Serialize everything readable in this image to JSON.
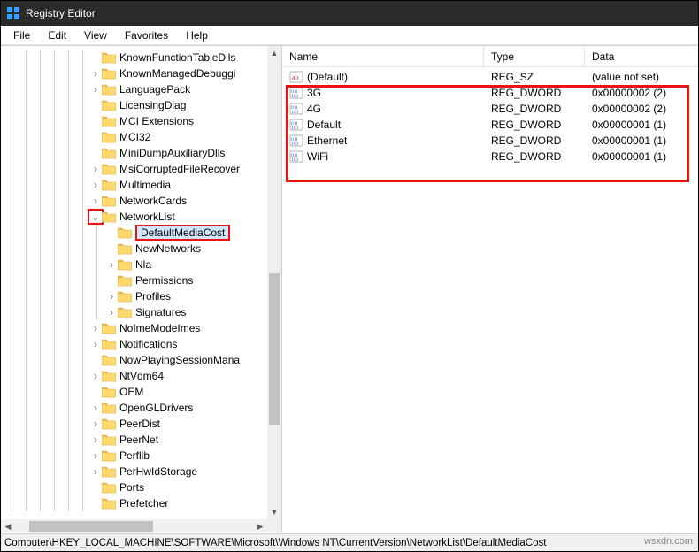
{
  "window": {
    "title": "Registry Editor"
  },
  "menu": {
    "file": "File",
    "edit": "Edit",
    "view": "View",
    "favorites": "Favorites",
    "help": "Help"
  },
  "tree": {
    "items": [
      {
        "label": "KnownFunctionTableDlls",
        "exp": "",
        "sub": false
      },
      {
        "label": "KnownManagedDebuggi",
        "exp": ">",
        "sub": false
      },
      {
        "label": "LanguagePack",
        "exp": ">",
        "sub": false
      },
      {
        "label": "LicensingDiag",
        "exp": "",
        "sub": false
      },
      {
        "label": "MCI Extensions",
        "exp": "",
        "sub": false
      },
      {
        "label": "MCI32",
        "exp": "",
        "sub": false
      },
      {
        "label": "MiniDumpAuxiliaryDlls",
        "exp": "",
        "sub": false
      },
      {
        "label": "MsiCorruptedFileRecover",
        "exp": ">",
        "sub": false
      },
      {
        "label": "Multimedia",
        "exp": ">",
        "sub": false
      },
      {
        "label": "NetworkCards",
        "exp": ">",
        "sub": false
      },
      {
        "label": "NetworkList",
        "exp": "v",
        "sub": false,
        "selexp": true
      },
      {
        "label": "DefaultMediaCost",
        "exp": "",
        "sub": true,
        "selected": true
      },
      {
        "label": "NewNetworks",
        "exp": "",
        "sub": true
      },
      {
        "label": "Nla",
        "exp": ">",
        "sub": true
      },
      {
        "label": "Permissions",
        "exp": "",
        "sub": true
      },
      {
        "label": "Profiles",
        "exp": ">",
        "sub": true
      },
      {
        "label": "Signatures",
        "exp": ">",
        "sub": true
      },
      {
        "label": "NoImeModeImes",
        "exp": ">",
        "sub": false
      },
      {
        "label": "Notifications",
        "exp": ">",
        "sub": false
      },
      {
        "label": "NowPlayingSessionMana",
        "exp": "",
        "sub": false
      },
      {
        "label": "NtVdm64",
        "exp": ">",
        "sub": false
      },
      {
        "label": "OEM",
        "exp": "",
        "sub": false
      },
      {
        "label": "OpenGLDrivers",
        "exp": ">",
        "sub": false
      },
      {
        "label": "PeerDist",
        "exp": ">",
        "sub": false
      },
      {
        "label": "PeerNet",
        "exp": ">",
        "sub": false
      },
      {
        "label": "Perflib",
        "exp": ">",
        "sub": false
      },
      {
        "label": "PerHwIdStorage",
        "exp": ">",
        "sub": false
      },
      {
        "label": "Ports",
        "exp": "",
        "sub": false
      },
      {
        "label": "Prefetcher",
        "exp": "",
        "sub": false
      }
    ]
  },
  "list": {
    "headers": {
      "name": "Name",
      "type": "Type",
      "data": "Data"
    },
    "rows": [
      {
        "icon": "sz",
        "name": "(Default)",
        "type": "REG_SZ",
        "data": "(value not set)"
      },
      {
        "icon": "dw",
        "name": "3G",
        "type": "REG_DWORD",
        "data": "0x00000002 (2)"
      },
      {
        "icon": "dw",
        "name": "4G",
        "type": "REG_DWORD",
        "data": "0x00000002 (2)"
      },
      {
        "icon": "dw",
        "name": "Default",
        "type": "REG_DWORD",
        "data": "0x00000001 (1)"
      },
      {
        "icon": "dw",
        "name": "Ethernet",
        "type": "REG_DWORD",
        "data": "0x00000001 (1)"
      },
      {
        "icon": "dw",
        "name": "WiFi",
        "type": "REG_DWORD",
        "data": "0x00000001 (1)"
      }
    ]
  },
  "status": {
    "path": "Computer\\HKEY_LOCAL_MACHINE\\SOFTWARE\\Microsoft\\Windows NT\\CurrentVersion\\NetworkList\\DefaultMediaCost"
  },
  "watermark": "wsxdn.com"
}
